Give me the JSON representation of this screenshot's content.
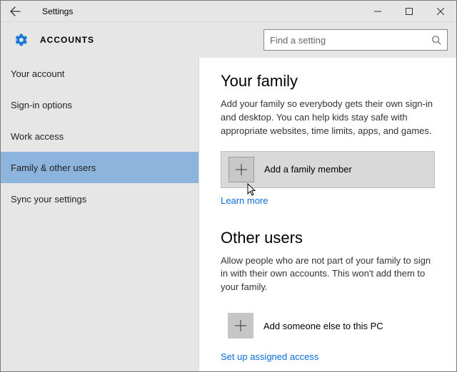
{
  "window": {
    "title": "Settings"
  },
  "header": {
    "section": "ACCOUNTS"
  },
  "search": {
    "placeholder": "Find a setting"
  },
  "sidebar": {
    "items": [
      {
        "label": "Your account"
      },
      {
        "label": "Sign-in options"
      },
      {
        "label": "Work access"
      },
      {
        "label": "Family & other users"
      },
      {
        "label": "Sync your settings"
      }
    ],
    "selected_index": 3
  },
  "main": {
    "family": {
      "title": "Your family",
      "description": "Add your family so everybody gets their own sign-in and desktop. You can help kids stay safe with appropriate websites, time limits, apps, and games.",
      "add_label": "Add a family member",
      "learn_more": "Learn more"
    },
    "other": {
      "title": "Other users",
      "description": "Allow people who are not part of your family to sign in with their own accounts. This won't add them to your family.",
      "add_label": "Add someone else to this PC",
      "assigned_access": "Set up assigned access"
    }
  },
  "colors": {
    "accent": "#1a78d6",
    "link": "#0a6dd8",
    "chrome_bg": "#e6e6e6",
    "selection": "#8cb4dc"
  }
}
